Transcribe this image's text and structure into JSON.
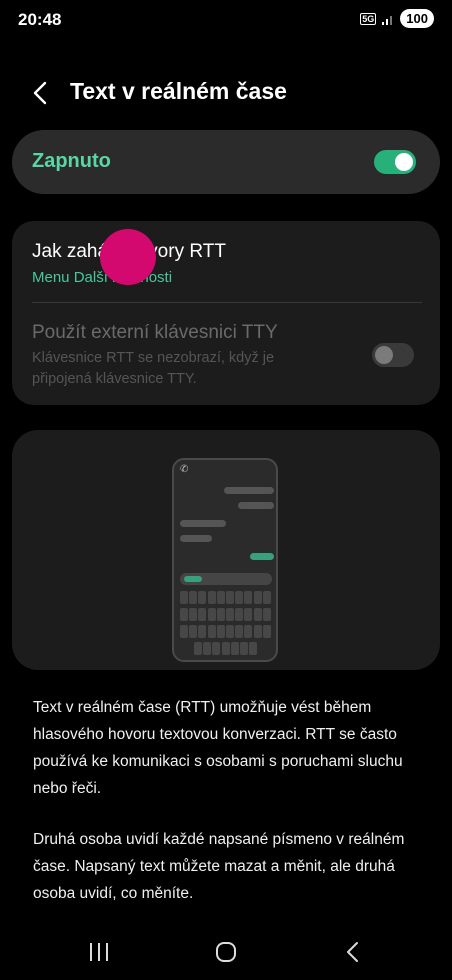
{
  "status_bar": {
    "time": "20:48",
    "network": "5G",
    "battery": "100"
  },
  "header": {
    "title": "Text v reálném čase"
  },
  "master_switch": {
    "label": "Zapnuto",
    "on": true
  },
  "settings": {
    "rtt_calls": {
      "title": "Jak zahájit hovory RTT",
      "subtitle": "Menu Další možnosti"
    },
    "tty_keyboard": {
      "title": "Použít externí klávesnici TTY",
      "subtitle": "Klávesnice RTT se nezobrazí, když je připojená klávesnice TTY.",
      "on": false
    }
  },
  "description": {
    "para1": "Text v reálném čase (RTT) umožňuje vést během hlasového hovoru textovou konverzaci. RTT se často používá ke komunikaci s osobami s poruchami sluchu nebo řeči.",
    "para2": "Druhá osoba uvidí každé napsané písmeno v reálném čase. Napsaný text můžete mazat a měnit, ale druhá osoba uvidí, co měníte."
  },
  "colors": {
    "accent": "#5ad6a5",
    "toggle_on": "#27b07a",
    "touch_indicator": "#d4096f"
  },
  "icons": {
    "back": "chevron-left-icon",
    "nav_recents": "recents-icon",
    "nav_home": "home-icon",
    "nav_back": "back-icon"
  }
}
